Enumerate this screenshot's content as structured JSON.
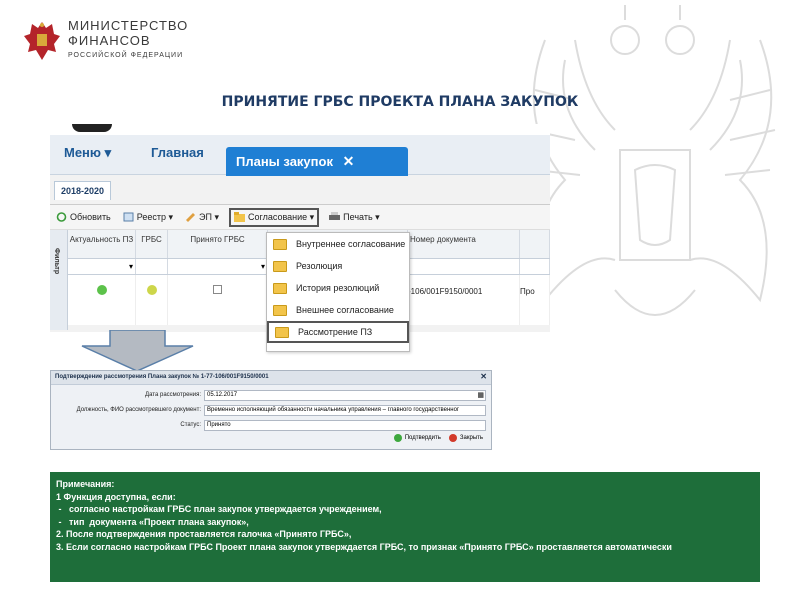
{
  "logo": {
    "line1": "МИНИСТЕРСТВО",
    "line2": "ФИНАНСОВ",
    "line3": "РОССИЙСКОЙ ФЕДЕРАЦИИ"
  },
  "page_title": "ПРИНЯТИЕ ГРБС ПРОЕКТА ПЛАНА ЗАКУПОК",
  "nav": {
    "menu": "Меню ▾",
    "main": "Главная",
    "active_tab": "Планы закупок",
    "close": "✕"
  },
  "year_tab": "2018-2020",
  "toolbar": {
    "refresh": "Обновить",
    "registry": "Реестр ▾",
    "ep": "ЭП ▾",
    "approval": "Согласование ▾",
    "print": "Печать ▾"
  },
  "grid": {
    "side_label": "Фильтр",
    "columns": [
      "Актуальность ПЗ",
      "ГРБС",
      "Принято ГРБС",
      "",
      "Номер документа",
      ""
    ],
    "row": {
      "doc_number": "-106/001F9150/0001",
      "last": "Про"
    }
  },
  "dropdown_menu": [
    "Внутреннее согласование",
    "Резолюция",
    "История резолюций",
    "Внешнее согласование",
    "Рассмотрение ПЗ"
  ],
  "dialog": {
    "title": "Подтверждение рассмотрения Плана закупок № 1-77-106/001F9150/0001",
    "date_label": "Дата рассмотрения:",
    "date_value": "05.12.2017",
    "position_label": "Должность, ФИО рассмотревшего документ:",
    "position_value": "Временно исполняющий обязанности начальника управления – главного государственног",
    "status_label": "Статус:",
    "status_value": "Принято",
    "confirm": "Подтвердить",
    "close": "Закрыть"
  },
  "notes": {
    "line1": "Примечания:",
    "line2": "1 Функция доступна, если:",
    "line3": " -   согласно настройкам ГРБС план закупок утверждается учреждением,",
    "line4": " -   тип  документа «Проект плана закупок»,",
    "line5": "2. После подтверждения проставляется галочка «Принято ГРБС»,",
    "line6": "3. Если согласно настройкам ГРБС Проект плана закупок утверждается ГРБС, то признак «Принято ГРБС» проставляется автоматически"
  },
  "colors": {
    "accent_blue": "#1f7fd4",
    "notes_green": "#1e6e3a",
    "title_blue": "#1f3b64"
  }
}
